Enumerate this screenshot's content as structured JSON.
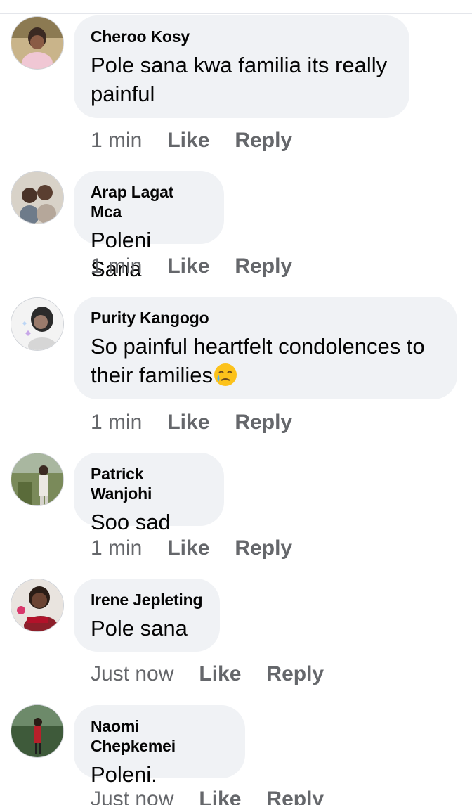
{
  "comments": [
    {
      "author": "Cheroo Kosy",
      "text": "Pole sana kwa familia its really painful",
      "time": "1 min",
      "like_label": "Like",
      "reply_label": "Reply"
    },
    {
      "author": "Arap Lagat Mca",
      "text": "Poleni Sana",
      "time": "1 min",
      "like_label": "Like",
      "reply_label": "Reply"
    },
    {
      "author": "Purity Kangogo",
      "text": "So painful  heartfelt condolences to their families",
      "emoji": "crying-face-emoji",
      "time": "1 min",
      "like_label": "Like",
      "reply_label": "Reply"
    },
    {
      "author": "Patrick Wanjohi",
      "text": "Soo sad",
      "time": "1 min",
      "like_label": "Like",
      "reply_label": "Reply"
    },
    {
      "author": "Irene Jepleting",
      "text": "Pole sana",
      "time": "Just now",
      "like_label": "Like",
      "reply_label": "Reply"
    },
    {
      "author": "Naomi Chepkemei",
      "text": "Poleni.",
      "time": "Just now",
      "like_label": "Like",
      "reply_label": "Reply"
    }
  ],
  "colors": {
    "bubble": "#f0f2f5",
    "author": "#050505",
    "meta": "#65676b"
  }
}
